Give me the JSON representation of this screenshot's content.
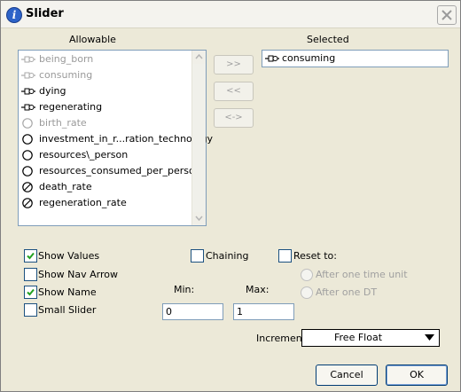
{
  "window": {
    "title": "Slider",
    "title_icon_glyph": "i"
  },
  "allowable": {
    "header": "Allowable",
    "items": [
      {
        "label": "being_born",
        "icon": "flow-icon",
        "dim": true
      },
      {
        "label": "consuming",
        "icon": "flow-icon",
        "dim": true
      },
      {
        "label": "dying",
        "icon": "flow-icon",
        "dim": false
      },
      {
        "label": "regenerating",
        "icon": "flow-icon",
        "dim": false
      },
      {
        "label": "birth_rate",
        "icon": "converter-icon",
        "dim": true
      },
      {
        "label": "investment_in_r...ration_technology",
        "icon": "converter-icon",
        "dim": false
      },
      {
        "label": "resources\\_person",
        "icon": "converter-icon",
        "dim": false
      },
      {
        "label": "resources_consumed_per_person",
        "icon": "converter-icon",
        "dim": false
      },
      {
        "label": "death_rate",
        "icon": "graphical-converter-icon",
        "dim": false
      },
      {
        "label": "regeneration_rate",
        "icon": "graphical-converter-icon",
        "dim": false
      }
    ]
  },
  "transfer": {
    "add_label": ">>",
    "remove_label": "<<",
    "swap_label": "<->"
  },
  "selected": {
    "header": "Selected",
    "items": [
      {
        "label": "consuming",
        "icon": "flow-icon"
      }
    ]
  },
  "options": {
    "show_values": {
      "label": "Show Values",
      "checked": true
    },
    "show_nav_arrow": {
      "label": "Show Nav Arrow",
      "checked": false
    },
    "show_name": {
      "label": "Show Name",
      "checked": true
    },
    "small_slider": {
      "label": "Small Slider",
      "checked": false
    },
    "chaining": {
      "label": "Chaining",
      "checked": false
    },
    "reset_to": {
      "label": "Reset to:",
      "checked": false
    },
    "after_one_time_unit": {
      "label": "After one time unit"
    },
    "after_one_dt": {
      "label": "After one DT"
    }
  },
  "range": {
    "min_label": "Min:",
    "min_value": "0",
    "max_label": "Max:",
    "max_value": "1"
  },
  "increment": {
    "label": "Increment:",
    "value": "Free Float"
  },
  "buttons": {
    "cancel": "Cancel",
    "ok": "OK"
  },
  "colors": {
    "titlebar": "#f4f3ee",
    "dialog": "#ece9d8",
    "checkmark": "#21a121",
    "listbox_border": "#7f9db9"
  }
}
